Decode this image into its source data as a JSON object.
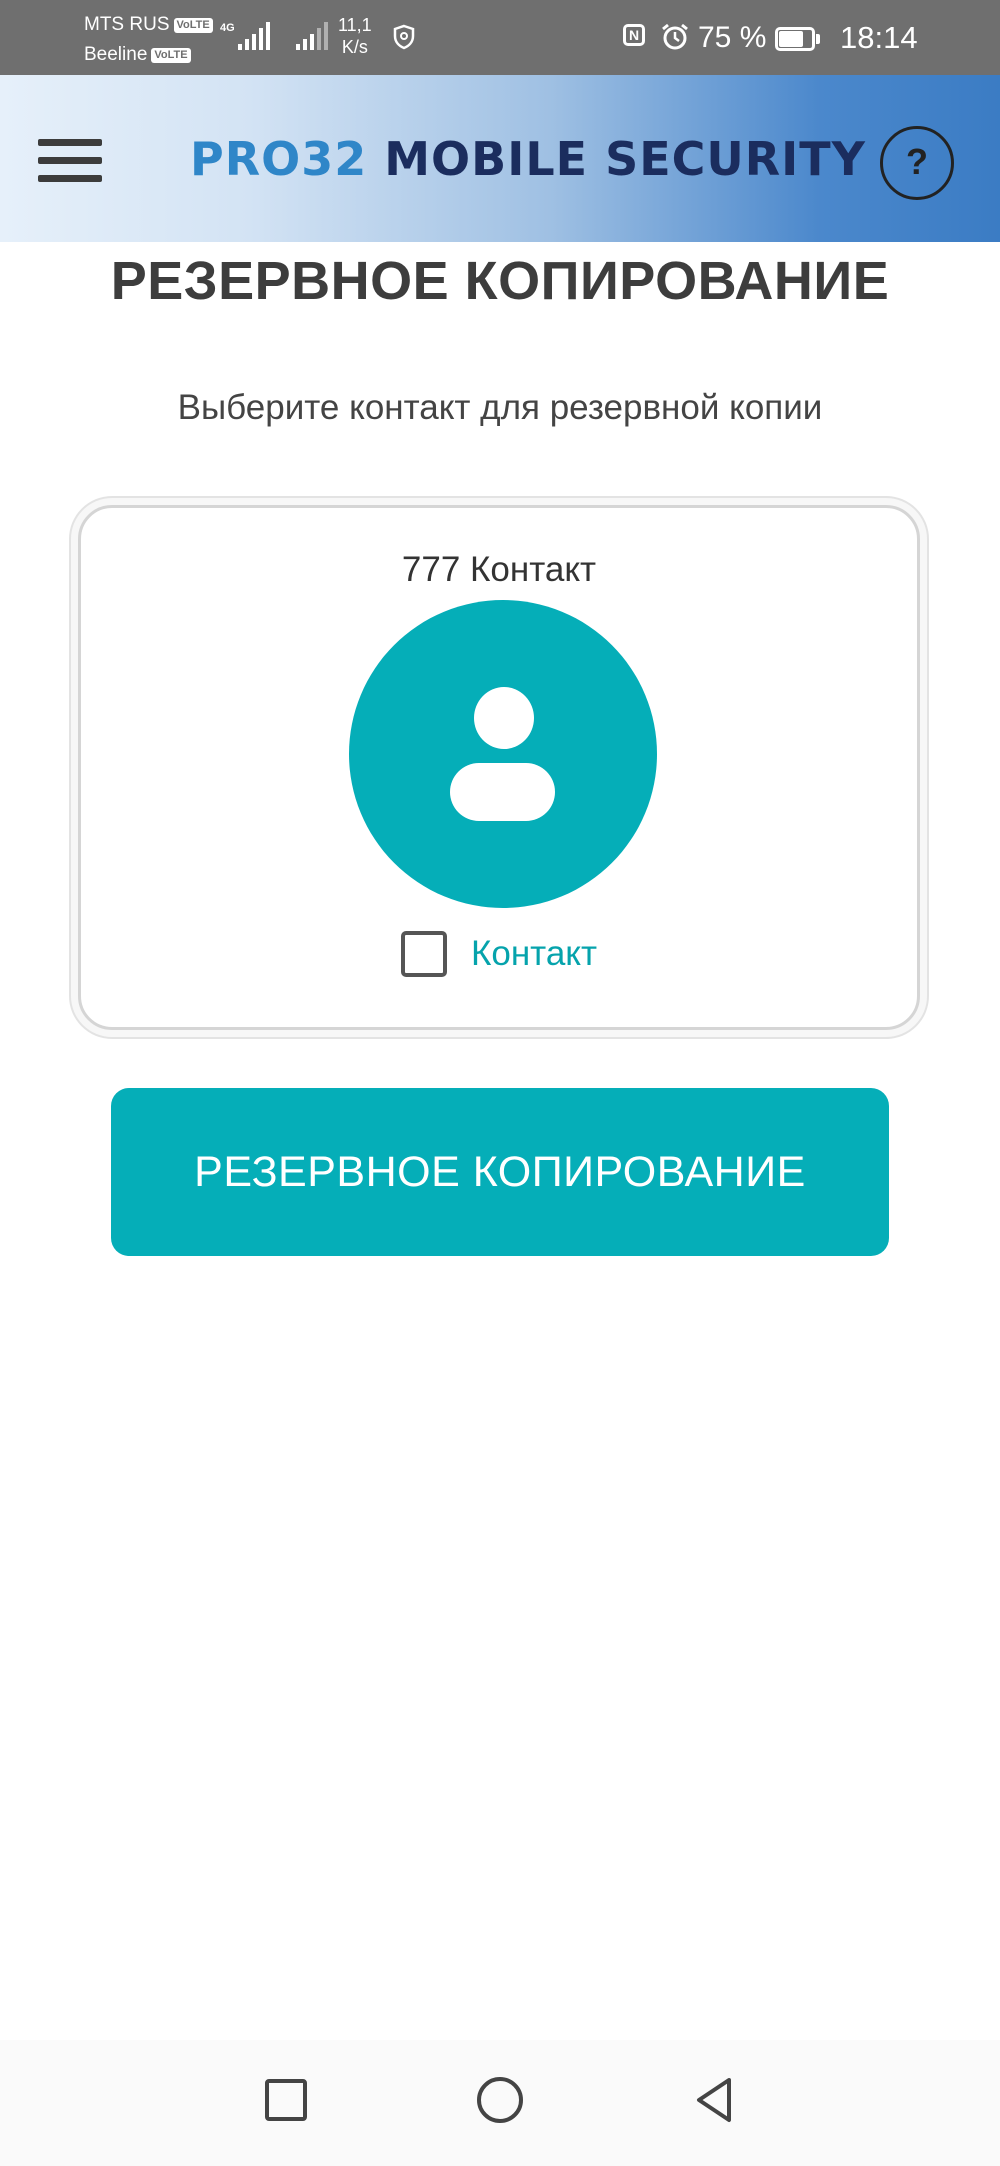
{
  "status_bar": {
    "carrier1": "MTS RUS",
    "carrier2": "Beeline",
    "volte_badge": "VoLTE",
    "network_type": "4G",
    "speed_value": "11,1",
    "speed_unit": "K/s",
    "battery_percent": "75 %",
    "battery_level": 0.75,
    "time": "18:14",
    "nfc_label": "N"
  },
  "header": {
    "logo_pro": "PRO32",
    "logo_rest": " MOBILE SECURITY",
    "help_label": "?"
  },
  "main": {
    "title": "РЕЗЕРВНОЕ КОПИРОВАНИЕ",
    "subtitle": "Выберите контакт для резервной копии",
    "contact": {
      "name": "777 Контакт",
      "checkbox_label": "Контакт",
      "checked": false
    },
    "backup_button_label": "РЕЗЕРВНОЕ КОПИРОВАНИЕ"
  },
  "colors": {
    "accent": "#05aeb8",
    "status_bar": "#6f6f6f",
    "logo_blue": "#2f86c8",
    "logo_navy": "#1b2d5e"
  },
  "icons": {
    "menu": "hamburger-icon",
    "help": "question-icon",
    "avatar": "person-icon",
    "nav_recent": "square-icon",
    "nav_home": "circle-icon",
    "nav_back": "triangle-back-icon"
  }
}
